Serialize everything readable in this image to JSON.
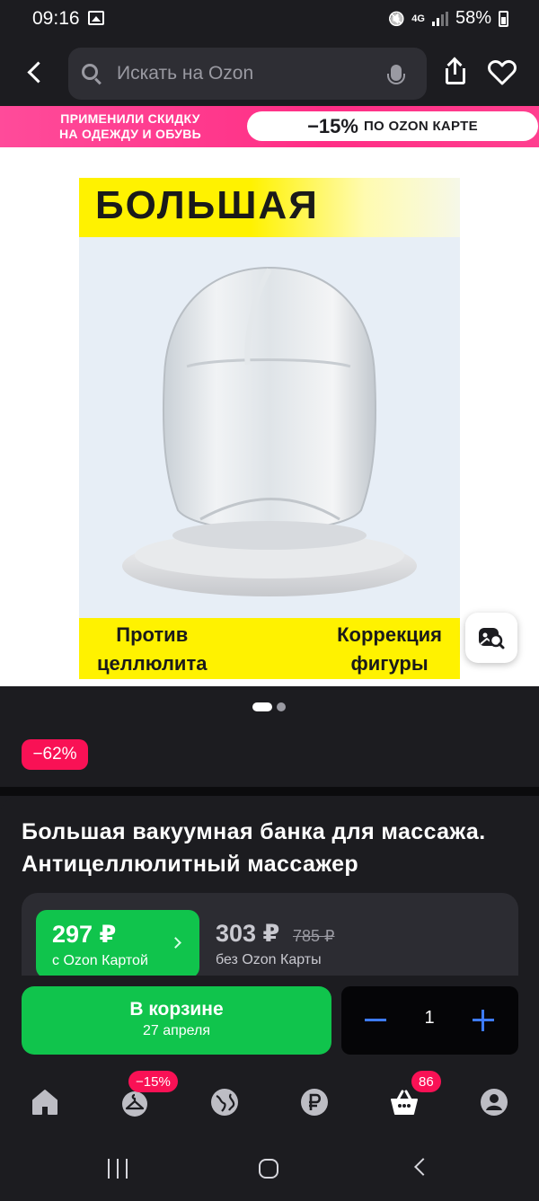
{
  "status_bar": {
    "time": "09:16",
    "network": "4G",
    "battery": "58%"
  },
  "header": {
    "search_placeholder": "Искать на Ozon"
  },
  "promo": {
    "left_line1": "ПРИМЕНИЛИ СКИДКУ",
    "left_line2": "НА ОДЕЖДУ И ОБУВЬ",
    "pill_percent": "−15%",
    "pill_text": "ПО OZON КАРТЕ"
  },
  "gallery": {
    "image_title": "БОЛЬШАЯ",
    "caption_left_1": "Против",
    "caption_left_2": "целлюлита",
    "caption_right_1": "Коррекция",
    "caption_right_2": "фигуры",
    "total_images": 2,
    "active_index": 0
  },
  "discount_badge": "−62%",
  "product": {
    "title": "Большая вакуумная банка для массажа. Антицеллюлитный массажер",
    "ozon_card_price": "297 ₽",
    "ozon_card_label": "с Ozon Картой",
    "regular_price": "303 ₽",
    "old_price": "785 ₽",
    "regular_label": "без Ozon Карты"
  },
  "cart": {
    "button_label": "В корзине",
    "delivery_date": "27 апреля",
    "quantity": "1"
  },
  "bottom_nav": {
    "items": [
      {
        "name": "home",
        "icon": "home-icon"
      },
      {
        "name": "catalog",
        "icon": "hanger-icon",
        "badge": "−15%"
      },
      {
        "name": "fresh",
        "icon": "globe-icon"
      },
      {
        "name": "finance",
        "icon": "ruble-icon"
      },
      {
        "name": "cart",
        "icon": "basket-icon",
        "badge": "86"
      },
      {
        "name": "profile",
        "icon": "profile-icon"
      }
    ]
  },
  "colors": {
    "accent_green": "#10c44c",
    "badge_red": "#f91155",
    "promo_pink": "#ff3f8f",
    "stepper_blue": "#3d7bff"
  }
}
